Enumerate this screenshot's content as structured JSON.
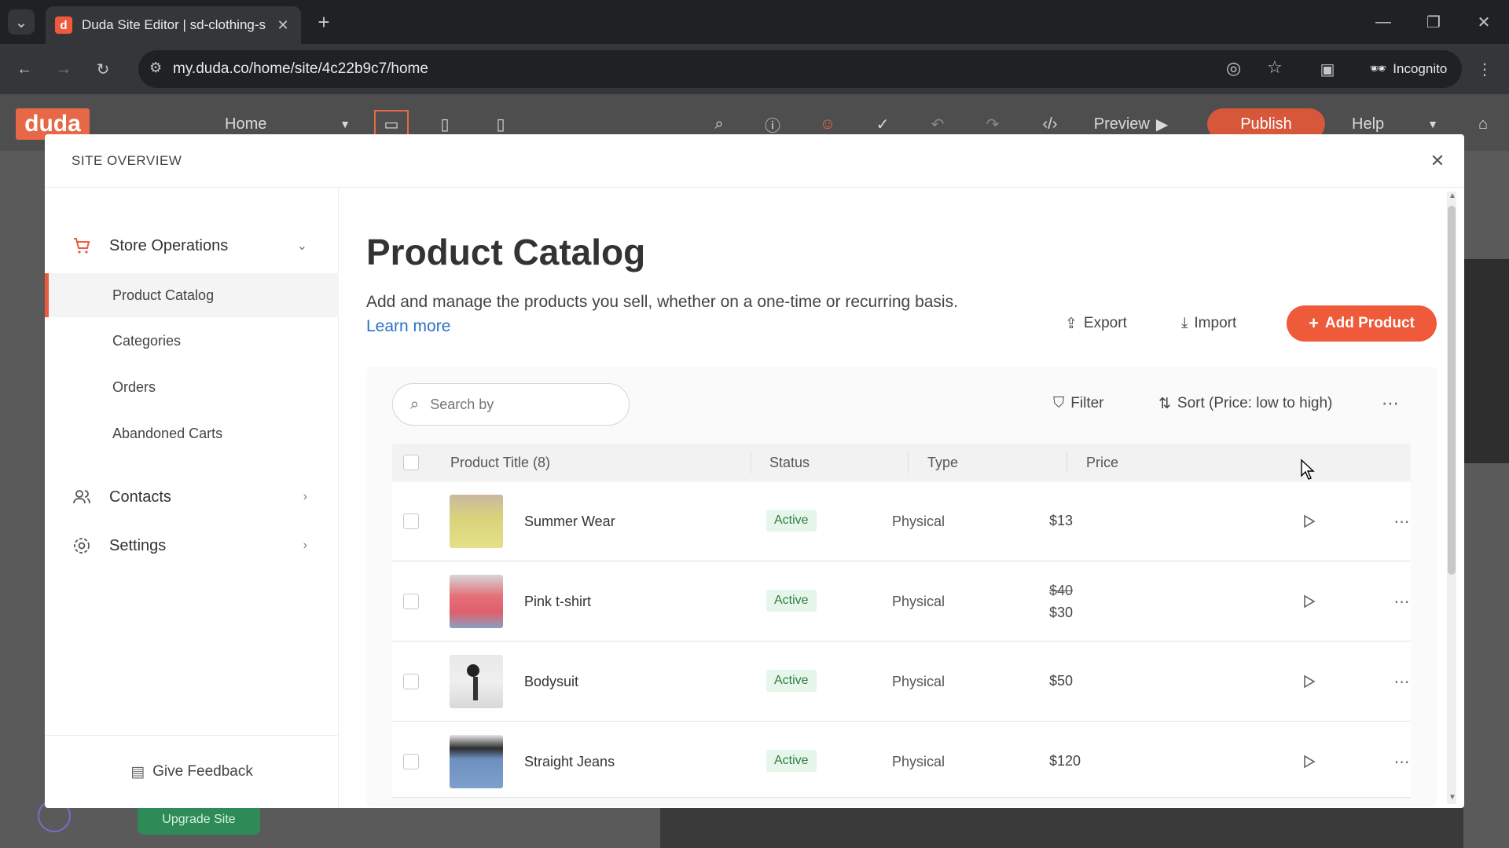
{
  "browser": {
    "tab_title": "Duda Site Editor | sd-clothing-s",
    "url": "my.duda.co/home/site/4c22b9c7/home",
    "incognito_label": "Incognito",
    "favicon_letter": "d"
  },
  "editor": {
    "logo": "duda",
    "page_select": "Home",
    "preview_label": "Preview",
    "publish_label": "Publish",
    "help_label": "Help",
    "upgrade_label": "Upgrade Site"
  },
  "modal": {
    "header": "SITE OVERVIEW"
  },
  "sidebar": {
    "groups": [
      {
        "label": "Store Operations",
        "icon": "cart-icon"
      },
      {
        "label": "Contacts",
        "icon": "contacts-icon"
      },
      {
        "label": "Settings",
        "icon": "gear-icon"
      }
    ],
    "sub_items": [
      "Product Catalog",
      "Categories",
      "Orders",
      "Abandoned Carts"
    ],
    "active_item": "Product Catalog",
    "feedback_label": "Give Feedback"
  },
  "main": {
    "title": "Product Catalog",
    "description": "Add and manage the products you sell, whether on a one-time or recurring basis.",
    "learn_more": "Learn more",
    "export_label": "Export",
    "import_label": "Import",
    "add_product_label": "Add Product",
    "search_placeholder": "Search by",
    "filter_label": "Filter",
    "sort_label": "Sort (Price: low to high)",
    "columns": [
      "Product Title (8)",
      "Status",
      "Type",
      "Price"
    ],
    "products": [
      {
        "title": "Summer Wear",
        "status": "Active",
        "type": "Physical",
        "price": "$13",
        "old_price": ""
      },
      {
        "title": "Pink t-shirt",
        "status": "Active",
        "type": "Physical",
        "price": "$30",
        "old_price": "$40"
      },
      {
        "title": "Bodysuit",
        "status": "Active",
        "type": "Physical",
        "price": "$50",
        "old_price": ""
      },
      {
        "title": "Straight Jeans",
        "status": "Active",
        "type": "Physical",
        "price": "$120",
        "old_price": ""
      }
    ]
  },
  "colors": {
    "accent": "#ee5a3a",
    "active_badge_bg": "#e6f6ea",
    "active_badge_text": "#2f7d44",
    "link": "#2a72c8"
  }
}
